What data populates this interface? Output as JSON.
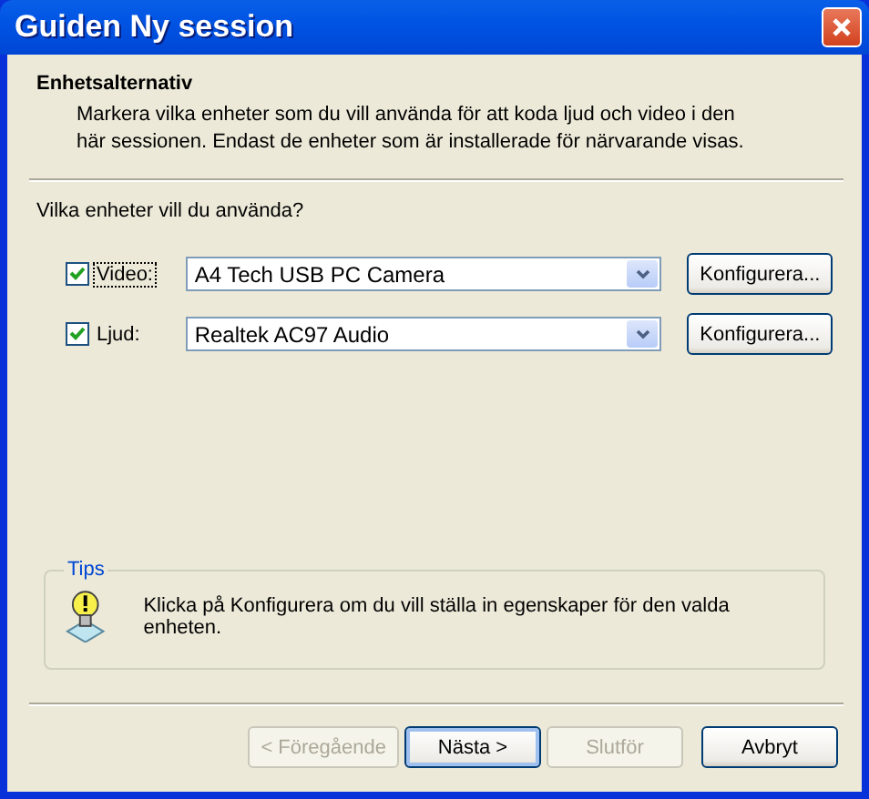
{
  "window": {
    "title": "Guiden Ny session"
  },
  "header": {
    "title": "Enhetsalternativ",
    "description": "Markera vilka enheter som du vill använda för att koda ljud och video i den här sessionen. Endast de enheter som är installerade för närvarande visas."
  },
  "question": "Vilka enheter vill du använda?",
  "devices": [
    {
      "label": "Video:",
      "checked": true,
      "focused": true,
      "value": "A4 Tech USB PC Camera",
      "button": "Konfigurera..."
    },
    {
      "label": "Ljud:",
      "checked": true,
      "focused": false,
      "value": "Realtek AC97 Audio",
      "button": "Konfigurera..."
    }
  ],
  "tips": {
    "legend": "Tips",
    "text": "Klicka på Konfigurera om du vill ställa in egenskaper för den valda enheten."
  },
  "buttons": [
    {
      "label": "< Föregående",
      "disabled": true,
      "default": false
    },
    {
      "label": "Nästa >",
      "disabled": false,
      "default": true
    },
    {
      "label": "Slutför",
      "disabled": true,
      "default": false
    },
    {
      "label": "Avbryt",
      "disabled": false,
      "default": false
    }
  ]
}
